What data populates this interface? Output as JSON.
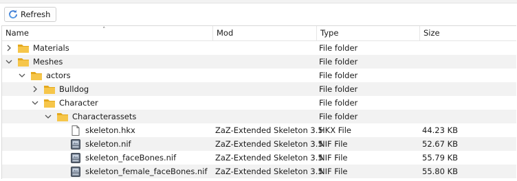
{
  "toolbar": {
    "refresh_label": "Refresh"
  },
  "columns": {
    "name": "Name",
    "mod": "Mod",
    "type": "Type",
    "size": "Size"
  },
  "rows": [
    {
      "name": "Materials",
      "mod": "",
      "type": "File folder",
      "size": "",
      "icon": "folder-icon",
      "expander": "collapsed"
    },
    {
      "name": "Meshes",
      "mod": "",
      "type": "File folder",
      "size": "",
      "icon": "folder-icon",
      "expander": "expanded"
    },
    {
      "name": "actors",
      "mod": "",
      "type": "File folder",
      "size": "",
      "icon": "folder-icon",
      "expander": "expanded"
    },
    {
      "name": "Bulldog",
      "mod": "",
      "type": "File folder",
      "size": "",
      "icon": "folder-icon",
      "expander": "collapsed"
    },
    {
      "name": "Character",
      "mod": "",
      "type": "File folder",
      "size": "",
      "icon": "folder-icon",
      "expander": "expanded"
    },
    {
      "name": "Characterassets",
      "mod": "",
      "type": "File folder",
      "size": "",
      "icon": "folder-icon",
      "expander": "expanded"
    },
    {
      "name": "skeleton.hkx",
      "mod": "ZaZ-Extended Skeleton 3.5",
      "type": "HKX File",
      "size": "44.23 KB",
      "icon": "file-icon",
      "expander": "none"
    },
    {
      "name": "skeleton.nif",
      "mod": "ZaZ-Extended Skeleton 3.5",
      "type": "NIF File",
      "size": "52.67 KB",
      "icon": "nif-file-icon",
      "expander": "none"
    },
    {
      "name": "skeleton_faceBones.nif",
      "mod": "ZaZ-Extended Skeleton 3.5",
      "type": "NIF File",
      "size": "55.79 KB",
      "icon": "nif-file-icon",
      "expander": "none"
    },
    {
      "name": "skeleton_female_faceBones.nif",
      "mod": "ZaZ-Extended Skeleton 3.5",
      "type": "NIF File",
      "size": "55.80 KB",
      "icon": "nif-file-icon",
      "expander": "none"
    }
  ],
  "colors": {
    "folder": "#f6c64a",
    "folder_dark": "#e3a81d",
    "alt_row": "#f2f2f2"
  }
}
